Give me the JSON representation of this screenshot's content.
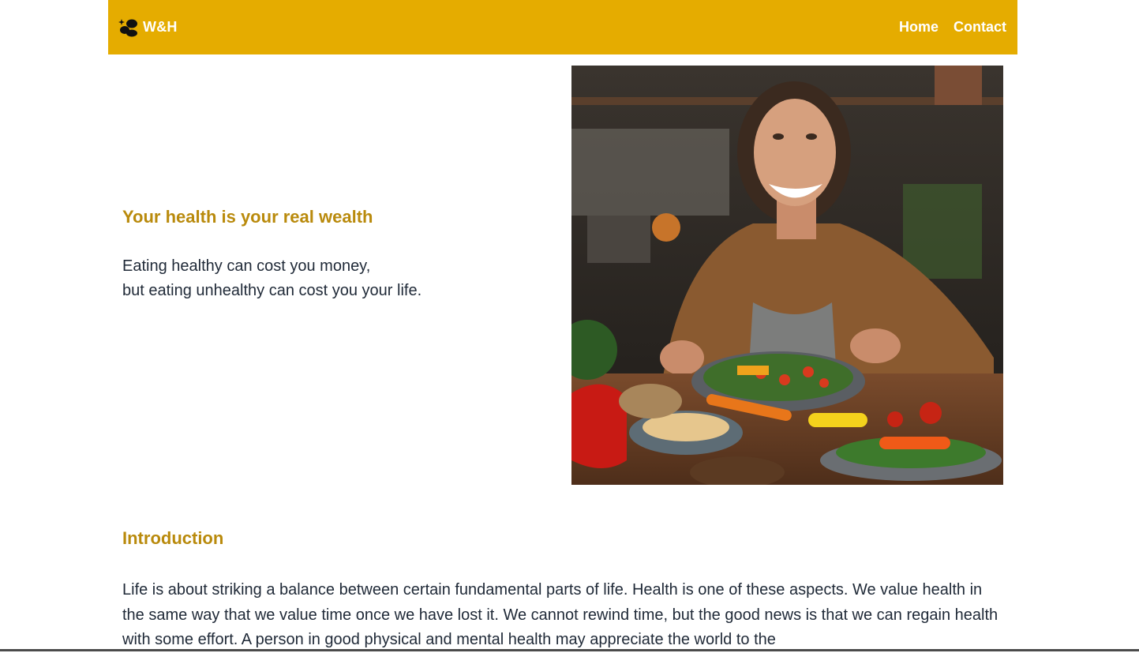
{
  "nav": {
    "brand": "W&H",
    "brand_icon": "wellness-blob-icon",
    "links": [
      "Home",
      "Contact"
    ]
  },
  "hero": {
    "title": "Your health is your real wealth",
    "quote_line1": "Eating healthy can cost you money,",
    "quote_line2": "but eating unhealthy can cost you your life.",
    "image_subject": "smiling-woman-with-vegetables-photo"
  },
  "intro": {
    "title": "Introduction",
    "text": "Life is about striking a balance between certain fundamental parts of life. Health is one of these aspects. We value health in the same way that we value time once we have lost it. We cannot rewind time, but the good news is that we can regain health with some effort. A person in good physical and mental health may appreciate the world to the"
  },
  "colors": {
    "accent": "#e5ac00",
    "heading": "#b98a0c",
    "text": "#1f2937"
  }
}
